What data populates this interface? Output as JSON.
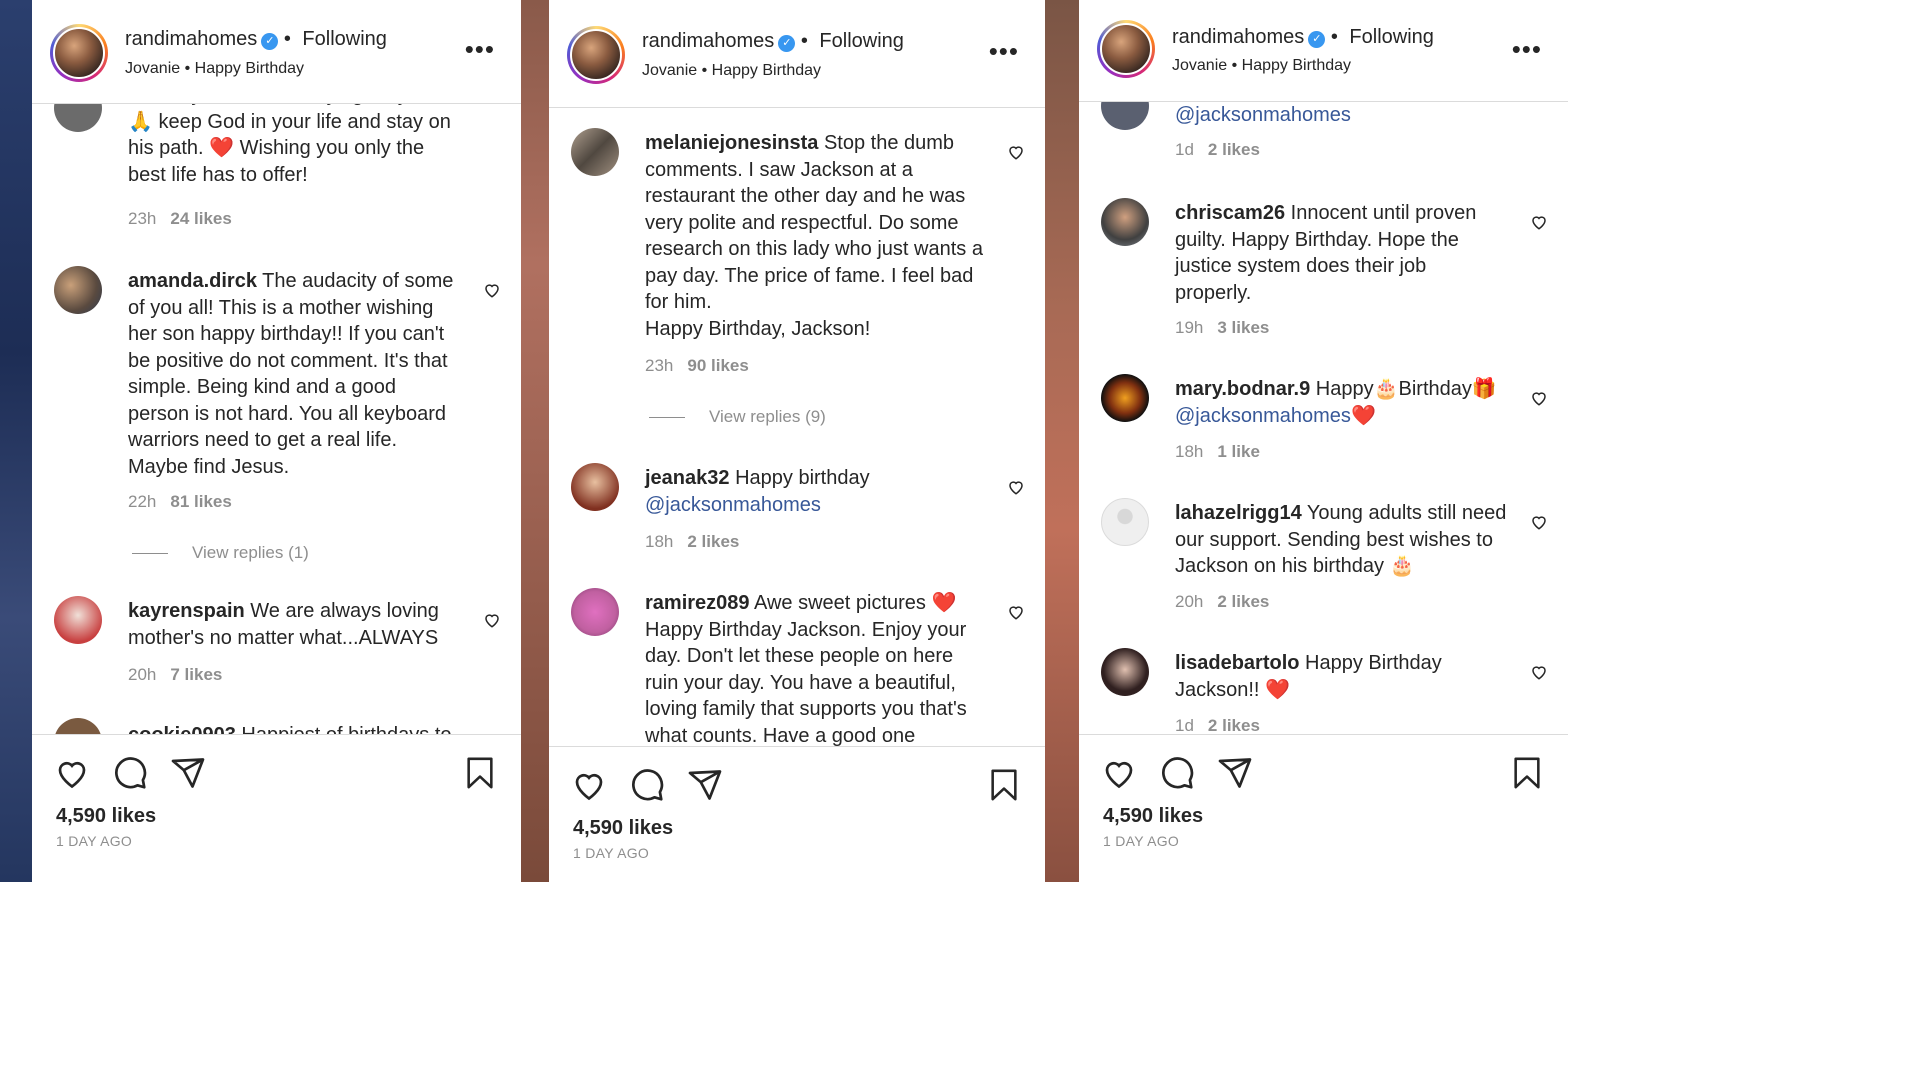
{
  "panels": [
    {
      "header": {
        "username": "randimahomes",
        "following": "Following",
        "sub": "Jovanie • Happy Birthday"
      },
      "comments": [
        {
          "user": "",
          "text": "Birthday, Jackson! Praying for you, 🙏 keep God in your life and stay on his path. ❤️ Wishing you only the best life has to offer!",
          "time": "23h",
          "likes": "24 likes"
        },
        {
          "user": "amanda.dirck",
          "text": " The audacity of some of you all! This is a mother wishing her son happy birthday!! If you can't be positive do not comment. It's that simple. Being kind and a good person is not hard. You all keyboard warriors need to get a real life. Maybe find Jesus.",
          "time": "22h",
          "likes": "81 likes",
          "replies": "View replies (1)"
        },
        {
          "user": "kayrenspain",
          "text": " We are always loving mother's no matter what...ALWAYS",
          "time": "20h",
          "likes": "7 likes"
        },
        {
          "user": "cookie0903",
          "text": " Happiest of birthdays to"
        }
      ],
      "footer": {
        "likes": "4,590 likes",
        "ago": "1 DAY AGO"
      }
    },
    {
      "header": {
        "username": "randimahomes",
        "following": "Following",
        "sub": "Jovanie • Happy Birthday"
      },
      "comments": [
        {
          "user": "melaniejonesinsta",
          "text": " Stop the dumb comments. I saw Jackson at a restaurant the other day and he was very polite and respectful. Do some research on this lady who just wants a pay day. The price of fame. I feel bad for him.",
          "text2": "Happy Birthday, Jackson!",
          "time": "23h",
          "likes": "90 likes",
          "replies": "View replies (9)"
        },
        {
          "user": "jeanak32",
          "text": " Happy birthday",
          "mention": "@jacksonmahomes",
          "time": "18h",
          "likes": "2 likes"
        },
        {
          "user": "ramirez089",
          "text": " Awe sweet pictures ❤️",
          "text2": "Happy Birthday Jackson. Enjoy your day. Don't let these people on here ruin your day. You have a beautiful, loving family that supports you that's what counts. Have a good one"
        }
      ],
      "footer": {
        "likes": "4,590 likes",
        "ago": "1 DAY AGO"
      }
    },
    {
      "header": {
        "username": "randimahomes",
        "following": "Following",
        "sub": "Jovanie • Happy Birthday"
      },
      "comments": [
        {
          "mention": "@jacksonmahomes",
          "time": "1d",
          "likes": "2 likes"
        },
        {
          "user": "chriscam26",
          "text": " Innocent until proven guilty. Happy Birthday. Hope the justice system does their job properly.",
          "time": "19h",
          "likes": "3 likes"
        },
        {
          "user": "mary.bodnar.9",
          "text": " Happy🎂Birthday🎁",
          "mention": "@jacksonmahomes",
          "tail": "❤️",
          "time": "18h",
          "likes": "1 like"
        },
        {
          "user": "lahazelrigg14",
          "text": " Young adults still need our support. Sending best wishes to Jackson on his birthday 🎂",
          "time": "20h",
          "likes": "2 likes"
        },
        {
          "user": "lisadebartolo",
          "text": " Happy Birthday Jackson!! ❤️",
          "time": "1d",
          "likes": "2 likes"
        }
      ],
      "footer": {
        "likes": "4,590 likes",
        "ago": "1 DAY AGO"
      }
    }
  ],
  "icons": {
    "like": "heart-icon",
    "comment": "comment-icon",
    "share": "send-icon",
    "save": "bookmark-icon",
    "more": "more-options-icon",
    "verified": "verified-badge-icon"
  }
}
